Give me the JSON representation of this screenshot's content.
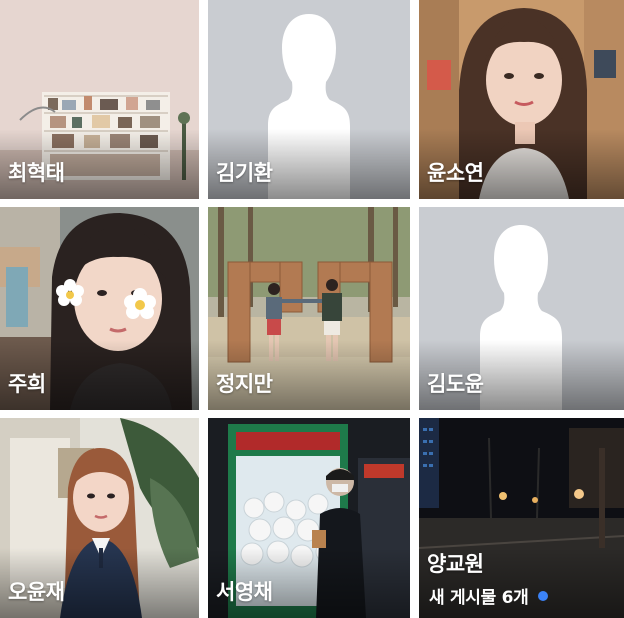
{
  "colors": {
    "placeholder_bg": "#c9ccd1",
    "silhouette": "#ffffff",
    "name_text": "#ffffff",
    "new_post_dot": "#3b82f6"
  },
  "friends": [
    {
      "name": "최혁태",
      "photo": "room-shelf-photo"
    },
    {
      "name": "김기환",
      "photo": "default-profile-silhouette"
    },
    {
      "name": "윤소연",
      "photo": "woman-selfie-photo"
    },
    {
      "name": "주희",
      "photo": "girl-flower-sticker-selfie-photo"
    },
    {
      "name": "정지만",
      "photo": "couple-outdoor-sculpture-photo"
    },
    {
      "name": "김도윤",
      "photo": "default-profile-silhouette"
    },
    {
      "name": "오윤재",
      "photo": "girl-uniform-outdoor-photo"
    },
    {
      "name": "서영채",
      "photo": "claw-machine-night-photo"
    },
    {
      "name": "양교원",
      "photo": "night-street-photo",
      "new_posts": "새 게시물 6개"
    }
  ]
}
